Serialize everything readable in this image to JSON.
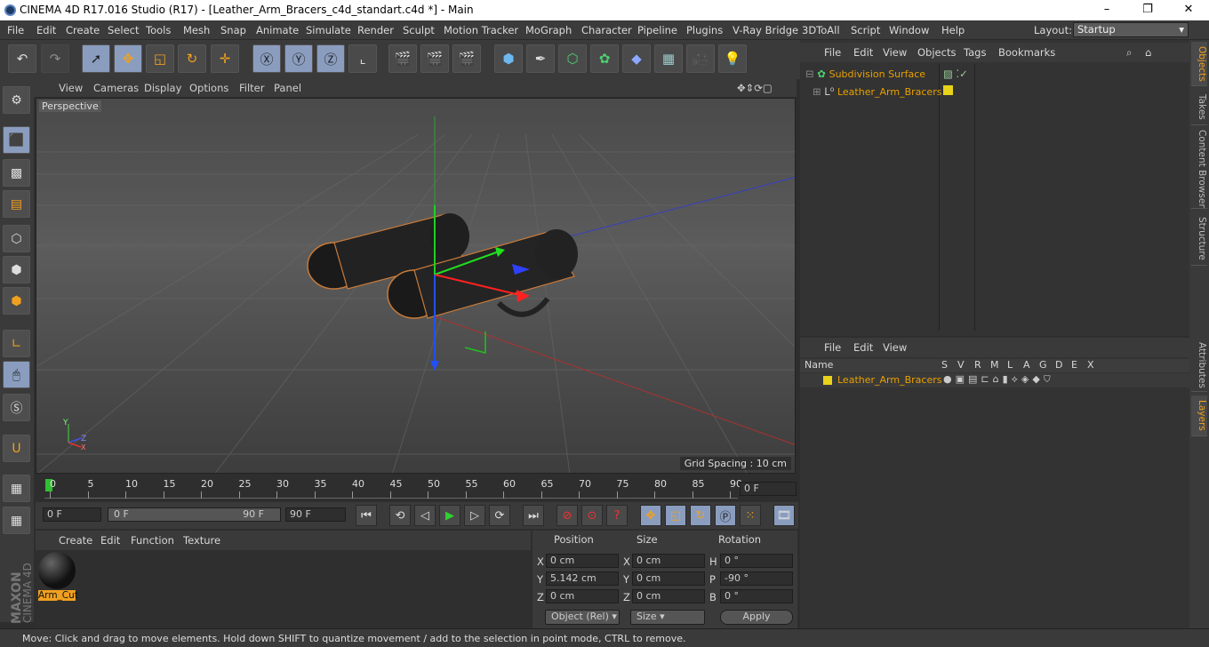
{
  "window": {
    "title": "CINEMA 4D R17.016 Studio (R17) - [Leather_Arm_Bracers_c4d_standart.c4d *] - Main",
    "minimize": "–",
    "maximize": "❐",
    "close": "✕"
  },
  "menu": [
    "File",
    "Edit",
    "Create",
    "Select",
    "Tools",
    "Mesh",
    "Snap",
    "Animate",
    "Simulate",
    "Render",
    "Sculpt",
    "Motion Tracker",
    "MoGraph",
    "Character",
    "Pipeline",
    "Plugins",
    "V-Ray Bridge",
    "3DToAll",
    "Script",
    "Window",
    "Help"
  ],
  "layout": {
    "label": "Layout:",
    "value": "Startup"
  },
  "viewport": {
    "menu": [
      "View",
      "Cameras",
      "Display",
      "Options",
      "Filter",
      "Panel"
    ],
    "label": "Perspective",
    "grid_spacing": "Grid Spacing : 10 cm",
    "axis_labels": {
      "y": "Y",
      "z": "Z",
      "x": "X"
    }
  },
  "timeline": {
    "ticks": [
      "0",
      "5",
      "10",
      "15",
      "20",
      "25",
      "30",
      "35",
      "40",
      "45",
      "50",
      "55",
      "60",
      "65",
      "70",
      "75",
      "80",
      "85",
      "90"
    ],
    "current_frame": "0 F"
  },
  "playback": {
    "start": "0 F",
    "range_start": "0 F",
    "range_end": "90 F",
    "end": "90 F"
  },
  "material": {
    "menu": [
      "Create",
      "Edit",
      "Function",
      "Texture"
    ],
    "items": [
      {
        "name": "Arm_Cut"
      }
    ]
  },
  "coordinates": {
    "headers": [
      "Position",
      "Size",
      "Rotation"
    ],
    "rows": [
      {
        "axis": "X",
        "pos": "0 cm",
        "size_axis": "X",
        "size": "0 cm",
        "rot_axis": "H",
        "rot": "0 °"
      },
      {
        "axis": "Y",
        "pos": "5.142 cm",
        "size_axis": "Y",
        "size": "0 cm",
        "rot_axis": "P",
        "rot": "-90 °"
      },
      {
        "axis": "Z",
        "pos": "0 cm",
        "size_axis": "Z",
        "size": "0 cm",
        "rot_axis": "B",
        "rot": "0 °"
      }
    ],
    "mode": "Object (Rel)",
    "size_mode": "Size",
    "apply": "Apply"
  },
  "objects": {
    "menu": [
      "File",
      "Edit",
      "View",
      "Objects",
      "Tags",
      "Bookmarks"
    ],
    "items": [
      {
        "name": "Subdivision Surface"
      },
      {
        "name": "Leather_Arm_Bracers"
      }
    ]
  },
  "layers": {
    "menu": [
      "File",
      "Edit",
      "View"
    ],
    "columns": [
      "Name",
      "S",
      "V",
      "R",
      "M",
      "L",
      "A",
      "G",
      "D",
      "E",
      "X"
    ],
    "items": [
      {
        "name": "Leather_Arm_Bracers"
      }
    ]
  },
  "side_tabs": [
    "Objects",
    "Takes",
    "Content Browser",
    "Structure",
    "Attributes",
    "Layers"
  ],
  "branding": {
    "maxon": "MAXON",
    "product": "CINEMA 4D"
  },
  "status": "Move: Click and drag to move elements. Hold down SHIFT to quantize movement / add to the selection in point mode, CTRL to remove.",
  "colors": {
    "accent": "#f0a020",
    "selection": "#8a9dbf",
    "layer": "#e8d21a"
  }
}
